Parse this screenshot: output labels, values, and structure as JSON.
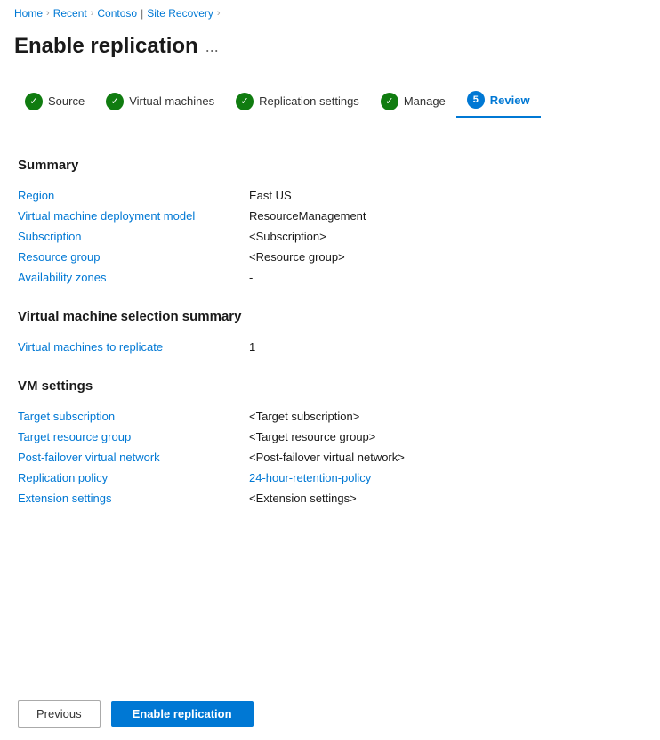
{
  "breadcrumb": {
    "home": "Home",
    "recent": "Recent",
    "contoso": "Contoso",
    "site_recovery": "Site Recovery",
    "separator": "›"
  },
  "page": {
    "title": "Enable replication",
    "dots_label": "..."
  },
  "steps": [
    {
      "id": "source",
      "label": "Source",
      "status": "complete"
    },
    {
      "id": "virtual-machines",
      "label": "Virtual machines",
      "status": "complete"
    },
    {
      "id": "replication-settings",
      "label": "Replication settings",
      "status": "complete"
    },
    {
      "id": "manage",
      "label": "Manage",
      "status": "complete"
    },
    {
      "id": "review",
      "label": "Review",
      "status": "active",
      "number": "5"
    }
  ],
  "summary": {
    "section_title": "Summary",
    "rows": [
      {
        "label": "Region",
        "value": "East US",
        "type": "text"
      },
      {
        "label": "Virtual machine deployment model",
        "value": "ResourceManagement",
        "type": "text"
      },
      {
        "label": "Subscription",
        "value": "<Subscription>",
        "type": "text"
      },
      {
        "label": "Resource group",
        "value": "<Resource group>",
        "type": "text"
      },
      {
        "label": "Availability zones",
        "value": "-",
        "type": "text"
      }
    ]
  },
  "vm_selection": {
    "section_title": "Virtual machine selection summary",
    "rows": [
      {
        "label": "Virtual machines to replicate",
        "value": "1",
        "type": "text"
      }
    ]
  },
  "vm_settings": {
    "section_title": "VM settings",
    "rows": [
      {
        "label": "Target subscription",
        "value": "<Target subscription>",
        "type": "text"
      },
      {
        "label": "Target resource group",
        "value": "<Target resource group>",
        "type": "text"
      },
      {
        "label": "Post-failover virtual network",
        "value": "<Post-failover virtual network>",
        "type": "text"
      },
      {
        "label": "Replication policy",
        "value": "24-hour-retention-policy",
        "type": "link"
      },
      {
        "label": "Extension settings",
        "value": "<Extension settings>",
        "type": "text"
      }
    ]
  },
  "footer": {
    "previous_label": "Previous",
    "enable_label": "Enable replication"
  }
}
